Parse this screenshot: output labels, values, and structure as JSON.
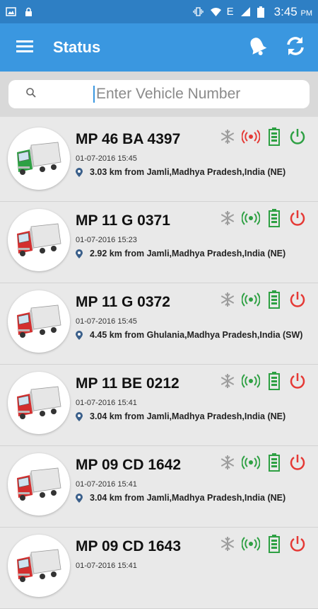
{
  "status_bar": {
    "time": "3:45",
    "ampm": "PM",
    "network": "E"
  },
  "app_bar": {
    "title": "Status"
  },
  "search": {
    "placeholder": "Enter Vehicle Number"
  },
  "vehicles": [
    {
      "number": "MP 46 BA 4397",
      "timestamp": "01-07-2016 15:45",
      "location": "3.03 km from Jamli,Madhya Pradesh,India (NE)",
      "truck_color": "#2ea043",
      "gps": "#e53935",
      "power": "#2ea043"
    },
    {
      "number": "MP 11 G 0371",
      "timestamp": "01-07-2016 15:23",
      "location": "2.92 km from Jamli,Madhya Pradesh,India (NE)",
      "truck_color": "#d32f2f",
      "gps": "#2ea043",
      "power": "#e53935"
    },
    {
      "number": "MP 11 G 0372",
      "timestamp": "01-07-2016 15:45",
      "location": "4.45 km from Ghulania,Madhya Pradesh,India (SW)",
      "truck_color": "#d32f2f",
      "gps": "#2ea043",
      "power": "#e53935"
    },
    {
      "number": "MP 11 BE 0212",
      "timestamp": "01-07-2016 15:41",
      "location": "3.04 km from Jamli,Madhya Pradesh,India (NE)",
      "truck_color": "#d32f2f",
      "gps": "#2ea043",
      "power": "#e53935"
    },
    {
      "number": "MP 09 CD 1642",
      "timestamp": "01-07-2016 15:41",
      "location": "3.04 km from Jamli,Madhya Pradesh,India (NE)",
      "truck_color": "#d32f2f",
      "gps": "#2ea043",
      "power": "#e53935"
    },
    {
      "number": "MP 09 CD 1643",
      "timestamp": "01-07-2016 15:41",
      "location": "",
      "truck_color": "#d32f2f",
      "gps": "#2ea043",
      "power": "#e53935"
    }
  ],
  "colors": {
    "status_bar": "#2e7fc4",
    "app_bar": "#3a97e0",
    "battery": "#2ea043",
    "snowflake": "#9e9e9e"
  }
}
